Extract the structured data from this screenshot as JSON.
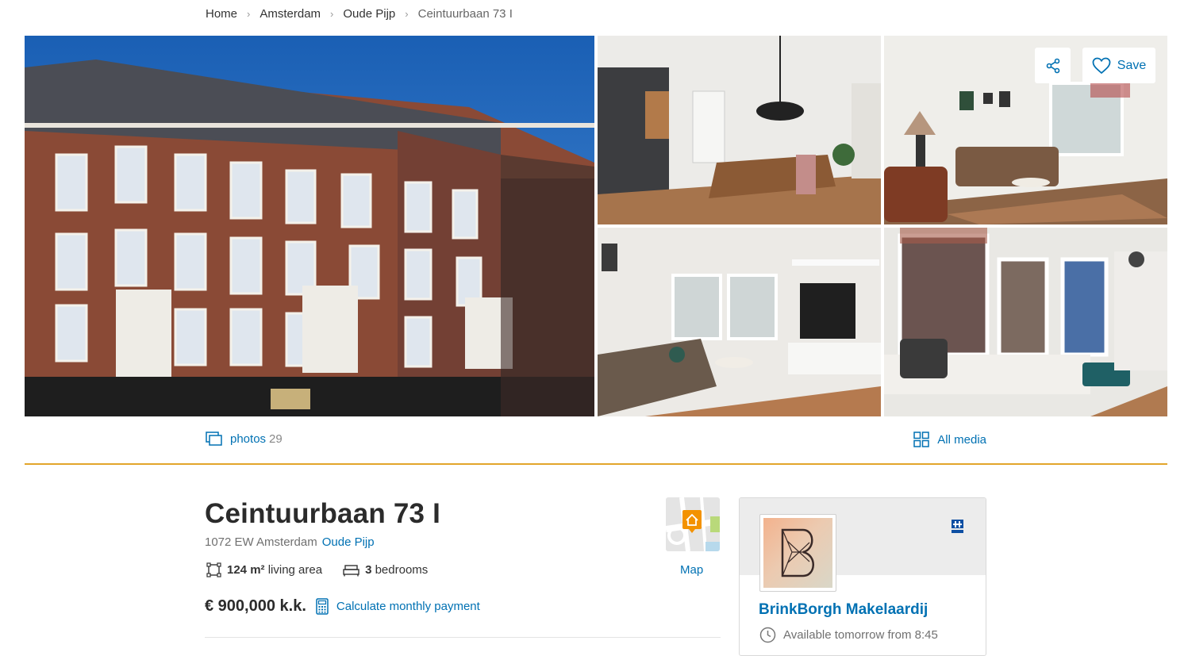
{
  "breadcrumb": {
    "items": [
      "Home",
      "Amsterdam",
      "Oude Pijp"
    ],
    "current": "Ceintuurbaan 73 I"
  },
  "gallery": {
    "save_label": "Save",
    "photos_label": "photos",
    "photos_count": "29",
    "all_media_label": "All media"
  },
  "listing": {
    "title": "Ceintuurbaan 73 I",
    "postal_city": "1072 EW Amsterdam",
    "neighbourhood": "Oude Pijp",
    "living_area_value": "124 m²",
    "living_area_label": "living area",
    "bedrooms_value": "3",
    "bedrooms_label": "bedrooms",
    "price": "€ 900,000 k.k.",
    "calc_label": "Calculate monthly payment",
    "map_label": "Map"
  },
  "agent": {
    "name": "BrinkBorgh Makelaardij",
    "availability": "Available tomorrow from 8:45"
  },
  "colors": {
    "link": "#0071b3",
    "divider": "#e2a52b",
    "map_pin": "#f39200"
  },
  "icons": [
    "chevron-right-icon",
    "share-icon",
    "heart-icon",
    "photos-icon",
    "grid-icon",
    "area-icon",
    "bed-icon",
    "calculator-icon",
    "map-pin-icon",
    "clock-icon",
    "nvm-logo-icon"
  ]
}
